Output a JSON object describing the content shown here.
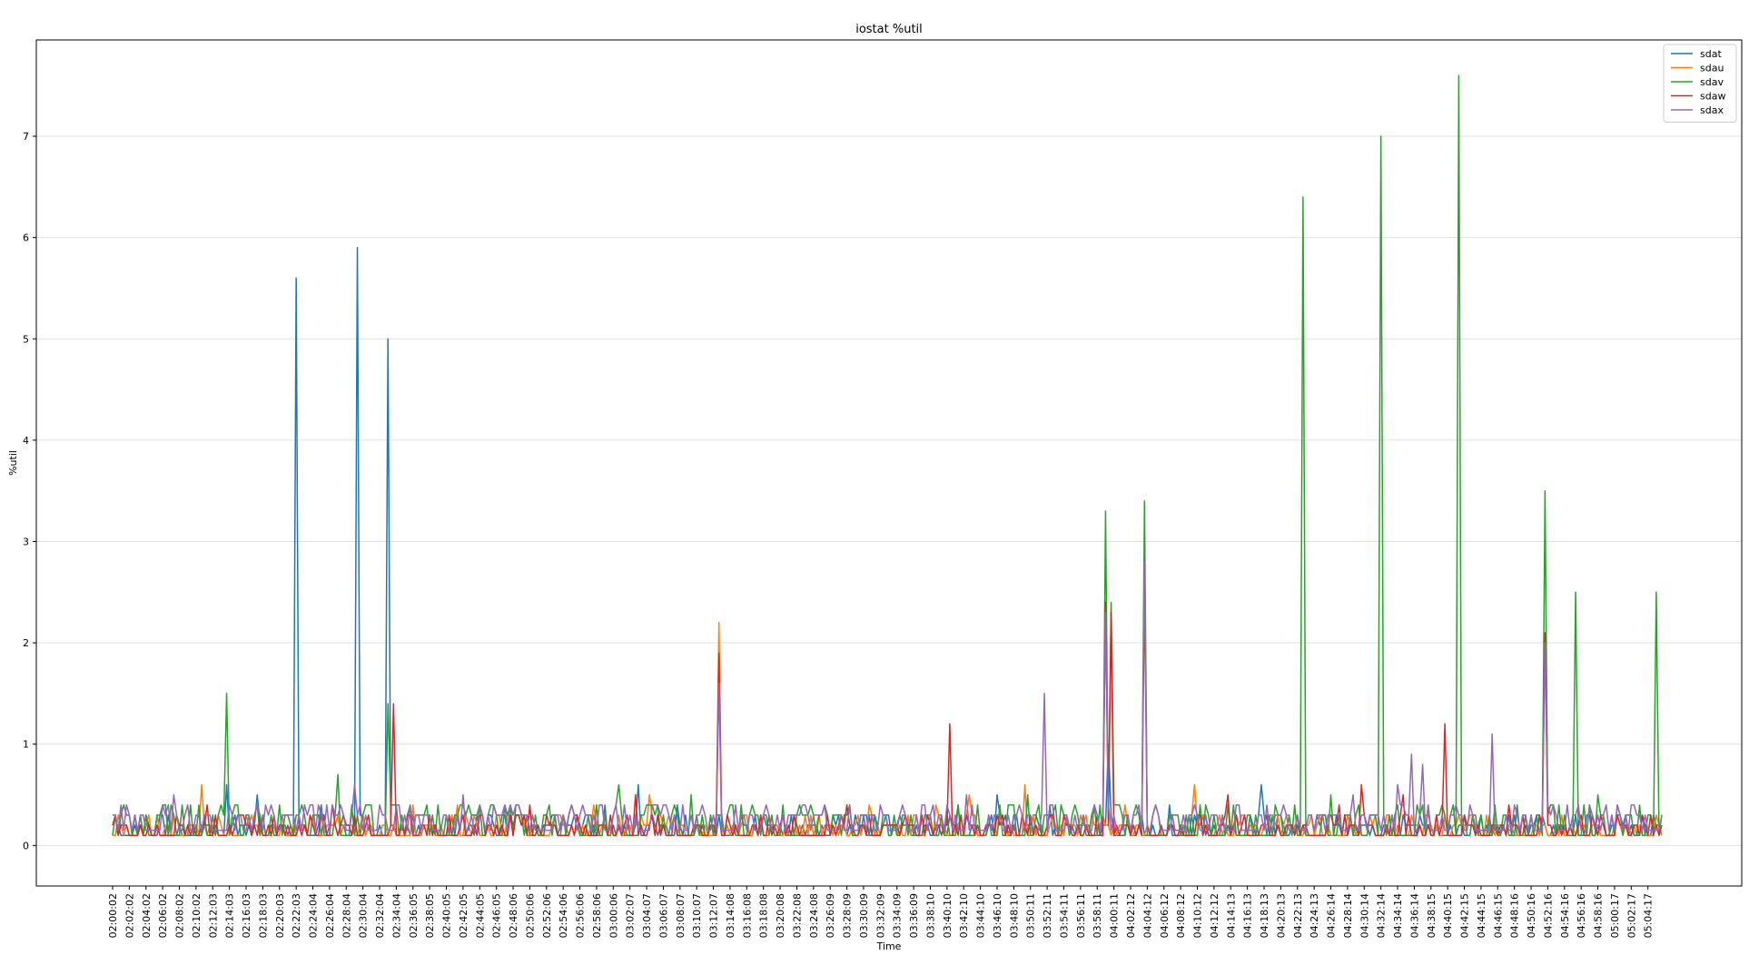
{
  "chart_data": {
    "type": "line",
    "title": "iostat %util",
    "xlabel": "Time",
    "ylabel": "%util",
    "ylim": [
      -0.4,
      7.95
    ],
    "yticks": [
      0,
      1,
      2,
      3,
      4,
      5,
      6,
      7
    ],
    "grid": "horizontal",
    "legend_position": "top-right",
    "x_ticks": [
      "02:00:02",
      "02:02:02",
      "02:04:02",
      "02:06:02",
      "02:08:02",
      "02:10:02",
      "02:12:03",
      "02:14:03",
      "02:16:03",
      "02:18:03",
      "02:20:03",
      "02:22:03",
      "02:24:04",
      "02:26:04",
      "02:28:04",
      "02:30:04",
      "02:32:04",
      "02:34:04",
      "02:36:05",
      "02:38:05",
      "02:40:05",
      "02:42:05",
      "02:44:05",
      "02:46:05",
      "02:48:06",
      "02:50:06",
      "02:52:06",
      "02:54:06",
      "02:56:06",
      "02:58:06",
      "03:00:06",
      "03:02:07",
      "03:04:07",
      "03:06:07",
      "03:08:07",
      "03:10:07",
      "03:12:07",
      "03:14:08",
      "03:16:08",
      "03:18:08",
      "03:20:08",
      "03:22:08",
      "03:24:08",
      "03:26:09",
      "03:28:09",
      "03:30:09",
      "03:32:09",
      "03:34:09",
      "03:36:09",
      "03:38:10",
      "03:40:10",
      "03:42:10",
      "03:44:10",
      "03:46:10",
      "03:48:10",
      "03:50:11",
      "03:52:11",
      "03:54:11",
      "03:56:11",
      "03:58:11",
      "04:00:11",
      "04:02:12",
      "04:04:12",
      "04:06:12",
      "04:08:12",
      "04:10:12",
      "04:12:12",
      "04:14:13",
      "04:16:13",
      "04:18:13",
      "04:20:13",
      "04:22:13",
      "04:24:13",
      "04:26:14",
      "04:28:14",
      "04:30:14",
      "04:32:14",
      "04:34:14",
      "04:36:14",
      "04:38:15",
      "04:40:15",
      "04:42:15",
      "04:44:15",
      "04:46:15",
      "04:48:16",
      "04:50:16",
      "04:52:16",
      "04:54:16",
      "04:56:16",
      "04:58:16",
      "05:00:17",
      "05:02:17",
      "05:04:17"
    ],
    "samples_per_tick": 6,
    "n_points": 558,
    "series": [
      {
        "name": "sdat",
        "color": "#1f77b4",
        "baseline": [
          0.1,
          0.2
        ],
        "peaks": [
          [
            35,
            0.1
          ],
          [
            55,
            0.6
          ],
          [
            69,
            0.5
          ],
          [
            75,
            0.1
          ],
          [
            88,
            5.6
          ],
          [
            100,
            0.4
          ],
          [
            118,
            5.9
          ],
          [
            133,
            5.0
          ],
          [
            160,
            0.1
          ],
          [
            182,
            0.3
          ],
          [
            198,
            0.3
          ],
          [
            229,
            0.3
          ],
          [
            237,
            0.4
          ],
          [
            253,
            0.6
          ],
          [
            262,
            0.1
          ],
          [
            272,
            0.4
          ],
          [
            302,
            0.3
          ],
          [
            345,
            0.1
          ],
          [
            372,
            0.3
          ],
          [
            393,
            0.1
          ],
          [
            407,
            0.4
          ],
          [
            425,
            0.5
          ],
          [
            451,
            0.4
          ],
          [
            479,
            1.0
          ],
          [
            508,
            0.4
          ],
          [
            542,
            0.1
          ],
          [
            552,
            0.6
          ]
        ]
      },
      {
        "name": "sdau",
        "color": "#ff7f0e",
        "baseline": [
          0.1,
          0.2
        ],
        "peaks": [
          [
            43,
            0.6
          ],
          [
            67,
            0.3
          ],
          [
            96,
            0.3
          ],
          [
            121,
            0.3
          ],
          [
            145,
            0.4
          ],
          [
            157,
            0.1
          ],
          [
            166,
            0.4
          ],
          [
            196,
            0.3
          ],
          [
            232,
            0.4
          ],
          [
            242,
            0.1
          ],
          [
            258,
            0.5
          ],
          [
            271,
            0.1
          ],
          [
            291,
            2.2
          ],
          [
            312,
            0.3
          ],
          [
            340,
            0.3
          ],
          [
            364,
            0.4
          ],
          [
            380,
            0.1
          ],
          [
            396,
            0.4
          ],
          [
            412,
            0.5
          ],
          [
            439,
            0.6
          ],
          [
            458,
            0.1
          ],
          [
            468,
            0.3
          ],
          [
            487,
            0.4
          ],
          [
            509,
            0.3
          ],
          [
            520,
            0.6
          ],
          [
            546,
            0.1
          ]
        ]
      },
      {
        "name": "sdav",
        "color": "#2ca02c",
        "baseline": [
          0.1,
          0.3
        ],
        "peaks": [
          [
            28,
            0.4
          ],
          [
            55,
            1.5
          ],
          [
            70,
            0.4
          ],
          [
            86,
            0.2
          ],
          [
            109,
            0.7
          ],
          [
            133,
            1.4
          ],
          [
            156,
            0.4
          ],
          [
            168,
            0.4
          ],
          [
            189,
            0.4
          ],
          [
            203,
            0.3
          ],
          [
            221,
            0.4
          ],
          [
            243,
            0.6
          ],
          [
            278,
            0.5
          ],
          [
            305,
            0.1
          ],
          [
            336,
            0.4
          ],
          [
            360,
            0.3
          ],
          [
            398,
            0.3
          ],
          [
            440,
            0.5
          ],
          [
            452,
            0.3
          ],
          [
            478,
            3.3
          ],
          [
            480,
            2.4
          ],
          [
            496,
            3.4
          ],
          [
            511,
            0.3
          ],
          [
            537,
            0.4
          ],
          [
            560,
            0.3
          ],
          [
            572,
            6.4
          ],
          [
            586,
            0.5
          ],
          [
            610,
            7.0
          ],
          [
            633,
            0.4
          ],
          [
            648,
            7.6
          ],
          [
            689,
            3.5
          ],
          [
            703,
            2.5
          ],
          [
            714,
            0.5
          ],
          [
            742,
            2.5
          ]
        ]
      },
      {
        "name": "sdaw",
        "color": "#d62728",
        "baseline": [
          0.1,
          0.2
        ],
        "peaks": [
          [
            45,
            0.4
          ],
          [
            78,
            0.3
          ],
          [
            105,
            0.4
          ],
          [
            135,
            1.4
          ],
          [
            147,
            0.1
          ],
          [
            178,
            0.3
          ],
          [
            200,
            0.4
          ],
          [
            224,
            0.3
          ],
          [
            251,
            0.5
          ],
          [
            275,
            0.1
          ],
          [
            291,
            1.9
          ],
          [
            322,
            0.3
          ],
          [
            353,
            0.4
          ],
          [
            381,
            0.3
          ],
          [
            402,
            1.2
          ],
          [
            417,
            0.1
          ],
          [
            428,
            0.3
          ],
          [
            452,
            0.3
          ],
          [
            478,
            2.4
          ],
          [
            480,
            2.3
          ],
          [
            496,
            2.5
          ],
          [
            521,
            0.3
          ],
          [
            537,
            0.5
          ],
          [
            555,
            0.3
          ],
          [
            590,
            0.4
          ],
          [
            600,
            0.6
          ],
          [
            621,
            0.5
          ],
          [
            641,
            1.2
          ],
          [
            672,
            0.4
          ],
          [
            689,
            2.1
          ],
          [
            711,
            0.3
          ],
          [
            735,
            0.3
          ]
        ]
      },
      {
        "name": "sdax",
        "color": "#9467bd",
        "baseline": [
          0.15,
          0.3
        ],
        "peaks": [
          [
            2,
            0.3
          ],
          [
            30,
            0.5
          ],
          [
            60,
            0.3
          ],
          [
            75,
            0.3
          ],
          [
            95,
            0.4
          ],
          [
            116,
            0.6
          ],
          [
            140,
            0.3
          ],
          [
            168,
            0.5
          ],
          [
            198,
            0.3
          ],
          [
            217,
            0.3
          ],
          [
            241,
            0.3
          ],
          [
            265,
            0.4
          ],
          [
            291,
            1.6
          ],
          [
            300,
            0.4
          ],
          [
            330,
            0.3
          ],
          [
            355,
            0.4
          ],
          [
            378,
            0.3
          ],
          [
            395,
            0.4
          ],
          [
            410,
            0.5
          ],
          [
            427,
            0.3
          ],
          [
            448,
            1.5
          ],
          [
            467,
            0.3
          ],
          [
            478,
            2.3
          ],
          [
            496,
            2.8
          ],
          [
            517,
            0.3
          ],
          [
            540,
            0.4
          ],
          [
            565,
            0.3
          ],
          [
            597,
            0.5
          ],
          [
            618,
            0.6
          ],
          [
            625,
            0.9
          ],
          [
            630,
            0.8
          ],
          [
            664,
            1.1
          ],
          [
            689,
            2.0
          ],
          [
            717,
            0.3
          ],
          [
            745,
            0.3
          ]
        ]
      }
    ]
  }
}
